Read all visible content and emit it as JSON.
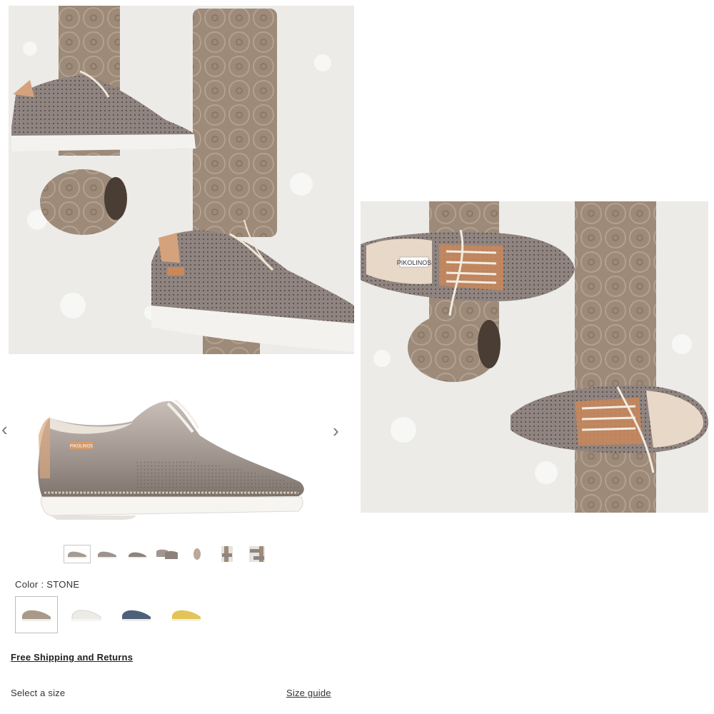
{
  "gallery": {
    "prev_icon": "chevron-left-icon",
    "next_icon": "chevron-right-icon",
    "thumbnails": [
      {
        "name": "thumb-side-view",
        "active": true
      },
      {
        "name": "thumb-side-view-2",
        "active": false
      },
      {
        "name": "thumb-side-view-3",
        "active": false
      },
      {
        "name": "thumb-pair-view",
        "active": false
      },
      {
        "name": "thumb-front-view",
        "active": false
      },
      {
        "name": "thumb-wall-photo-1",
        "active": false
      },
      {
        "name": "thumb-wall-photo-2",
        "active": false
      }
    ],
    "brand_tag": "PIKOLINOS"
  },
  "product": {
    "color_label": "Color : STONE",
    "swatch_colors": [
      {
        "name": "stone",
        "hex": "#a8998a",
        "active": true
      },
      {
        "name": "white",
        "hex": "#eeeeea",
        "active": false
      },
      {
        "name": "blue",
        "hex": "#4e6078",
        "active": false
      },
      {
        "name": "yellow",
        "hex": "#e3c456",
        "active": false
      }
    ],
    "shipping_link": "Free Shipping and Returns",
    "size_label": "Select a size",
    "size_guide_link": "Size guide"
  },
  "photos": {
    "insole_brand": "PIKOLINOS"
  },
  "colors": {
    "metallic": "#8c8078",
    "taupe": "#9e8a78",
    "tan": "#d4a27c",
    "sole": "#f4f2ee",
    "wall": "#ecebe8"
  }
}
